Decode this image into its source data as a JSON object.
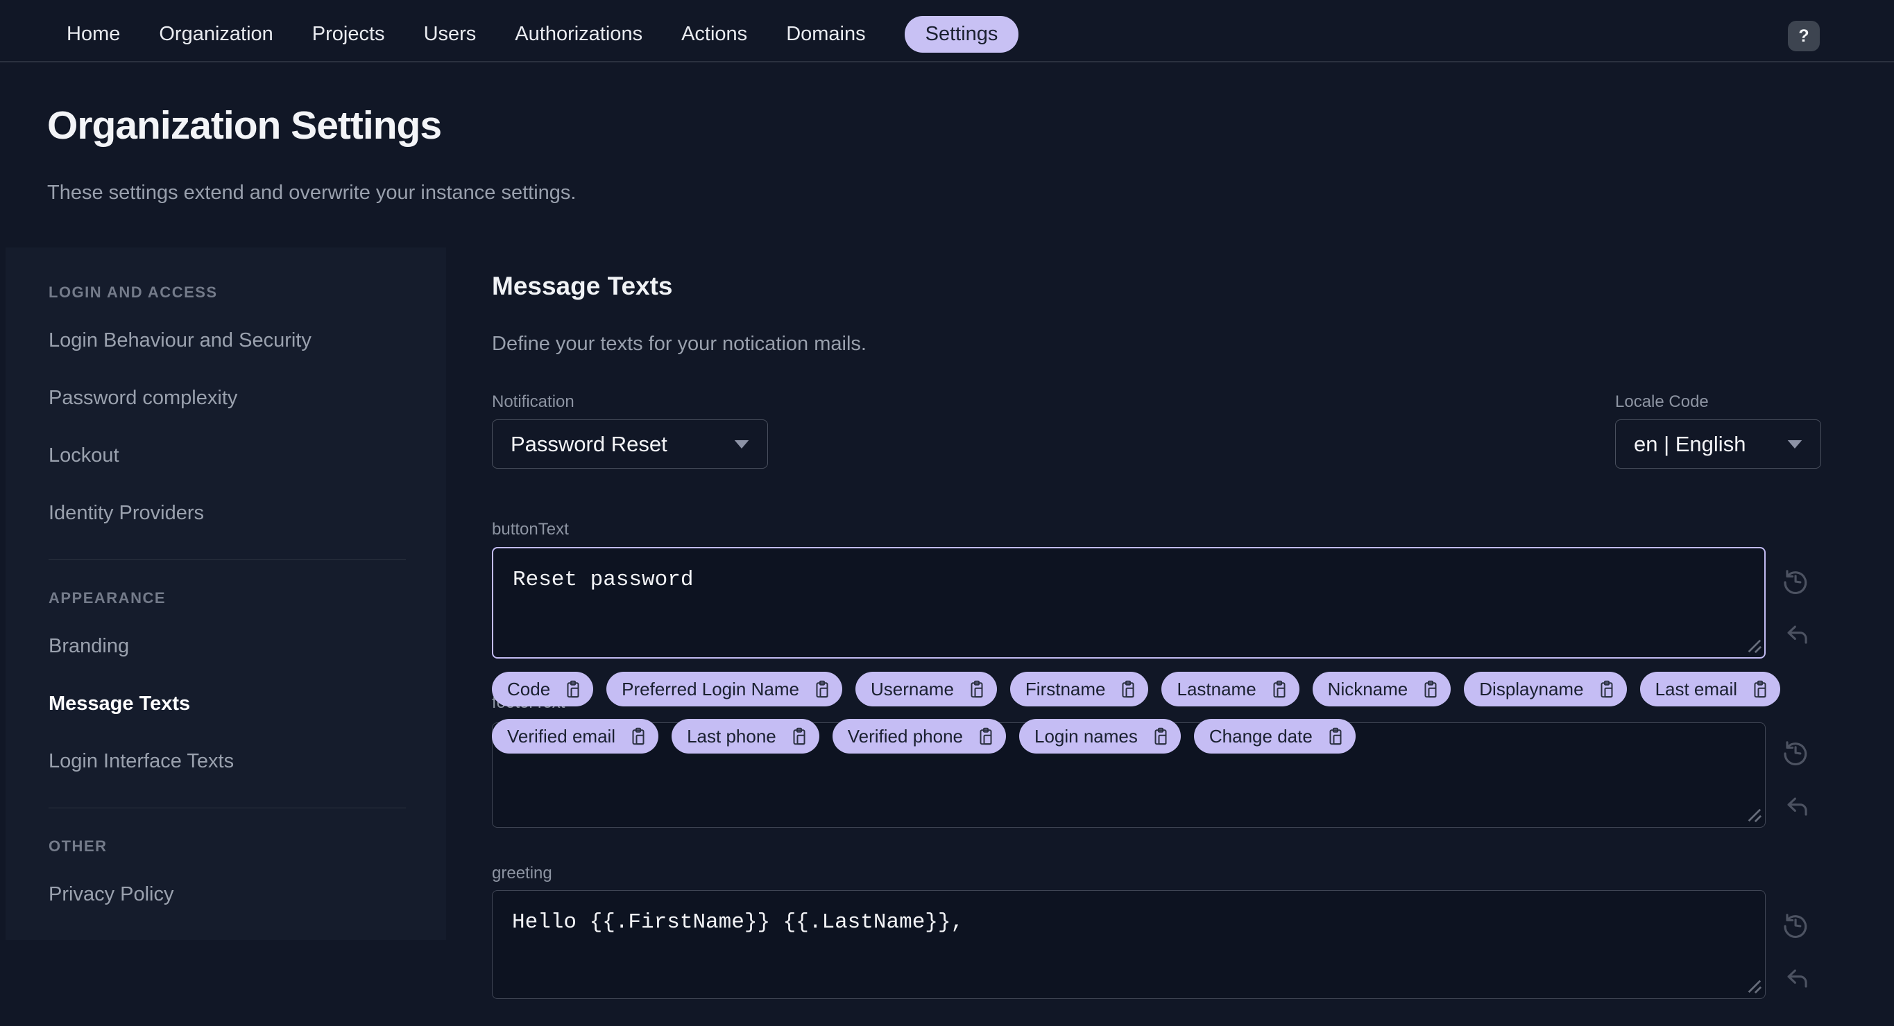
{
  "nav": {
    "items": [
      "Home",
      "Organization",
      "Projects",
      "Users",
      "Authorizations",
      "Actions",
      "Domains"
    ],
    "active_item": "Settings",
    "help_button": "?"
  },
  "page": {
    "title": "Organization Settings",
    "subtitle": "These settings extend and overwrite your instance settings."
  },
  "sidebar": {
    "sections": [
      {
        "header": "LOGIN AND ACCESS",
        "items": [
          "Login Behaviour and Security",
          "Password complexity",
          "Lockout",
          "Identity Providers"
        ]
      },
      {
        "header": "APPEARANCE",
        "items": [
          "Branding",
          "Message Texts",
          "Login Interface Texts"
        ]
      },
      {
        "header": "OTHER",
        "items": [
          "Privacy Policy"
        ]
      }
    ],
    "active_item": "Message Texts"
  },
  "main": {
    "heading": "Message Texts",
    "description": "Define your texts for your notication mails.",
    "notification": {
      "label": "Notification",
      "value": "Password Reset"
    },
    "locale": {
      "label": "Locale Code",
      "value": "en | English"
    },
    "fields": {
      "buttonText": {
        "label": "buttonText",
        "value": "Reset password"
      },
      "footerText": {
        "label": "footerText",
        "value": ""
      },
      "greeting": {
        "label": "greeting",
        "value": "Hello {{.FirstName}} {{.LastName}},"
      }
    },
    "chips": {
      "row1": [
        "Code",
        "Preferred Login Name",
        "Username",
        "Firstname",
        "Lastname",
        "Nickname",
        "Displayname",
        "Last email"
      ],
      "row2": [
        "Verified email",
        "Last phone",
        "Verified phone",
        "Login names",
        "Change date"
      ]
    }
  },
  "colors": {
    "background": "#111726",
    "sidebar_background": "#151c2c",
    "accent": "#c5bdf4",
    "focused_border": "#c2bbf2",
    "input_border": "#3f4554",
    "muted_text": "#99a0ad"
  }
}
